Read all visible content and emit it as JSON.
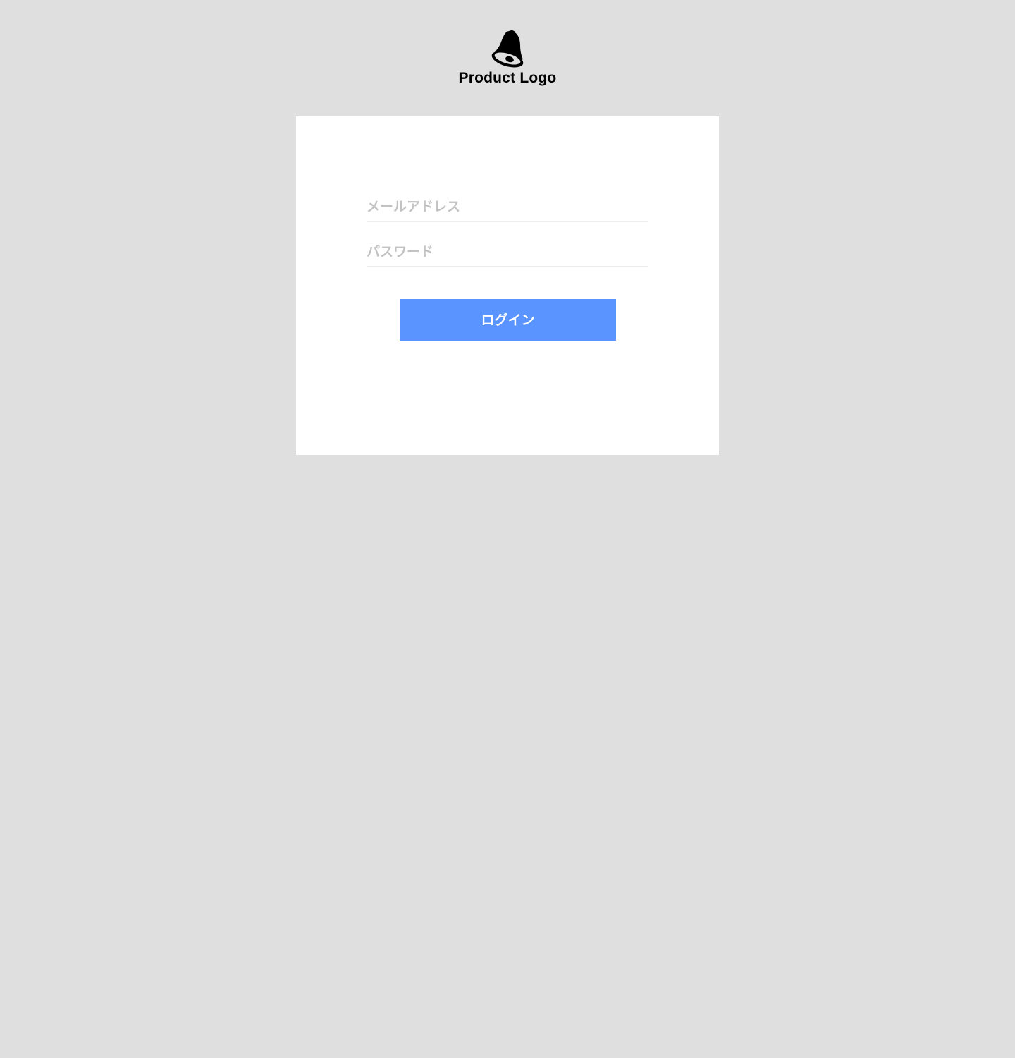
{
  "logo": {
    "text": "Product Logo",
    "icon": "bell-icon"
  },
  "login_form": {
    "email": {
      "placeholder": "メールアドレス",
      "value": ""
    },
    "password": {
      "placeholder": "パスワード",
      "value": ""
    },
    "submit_label": "ログイン"
  },
  "colors": {
    "page_background": "#dfdfdf",
    "card_background": "#ffffff",
    "button_background": "#5a95ff",
    "button_text": "#ffffff",
    "placeholder_text": "#c2c2c2",
    "field_underline": "#ececec",
    "logo": "#000000"
  }
}
